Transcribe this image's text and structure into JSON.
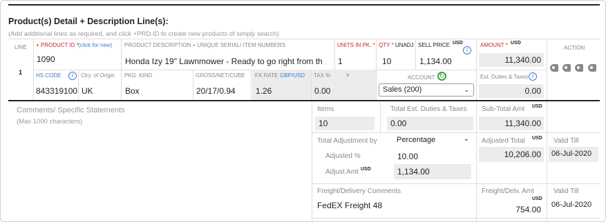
{
  "header": {
    "title": "Product(s) Detail + Description Line(s):",
    "subtitle": "(Add additional lines as required, and click +PRD.ID to create new products of simply search)"
  },
  "line": {
    "line_label": "LINE",
    "line_number": "1",
    "product_id_label": "+ PRODUCT ID",
    "product_id_req": "*",
    "product_id_link": "(click for new)",
    "product_id_value": "1090",
    "description_label": "PRODUCT DESCRIPTION + UNIQUE SERIAL/ ITEM NUMBERS",
    "description_value": "Honda Izy 19\" Lawnmower - Ready to go right from th",
    "units_label": "UNITS IN PK.",
    "units_req": "*",
    "units_value": "1",
    "qty_label": "QTY",
    "qty_req": "*",
    "qty_unit": "UNADJ",
    "qty_value": "10",
    "sell_price_label": "SELL PRICE",
    "sell_price_currency": "USD",
    "sell_price_value": "1,134.00",
    "amount_label": "AMOUNT",
    "amount_req": "*",
    "amount_currency": "USD",
    "amount_value": "11,340.00",
    "action_label": "ACTION",
    "hs_code_label": "HS CODE",
    "hs_code_value": "843319100",
    "origin_label": "Ctry. of Origin",
    "origin_value": "UK",
    "pkg_kind_label": "PKG. KIND",
    "pkg_kind_value": "Box",
    "gross_label": "GROSS/NET/CUBE",
    "gross_value": "20/17/0.94",
    "fx_label": "FX RATE",
    "fx_pair": "GBP/USD",
    "fx_value": "1.26",
    "tax_label": "TAX %",
    "tax_value": "0.00",
    "account_label": "ACCOUNT",
    "account_value": "Sales (200)",
    "duties_label": "Est. Duties & Taxes",
    "duties_value": "0.00"
  },
  "summary": {
    "comments_label": "Comments/ Specific Statements",
    "comments_hint": "(Max 1000 characters)",
    "items_label": "Items",
    "items_value": "10",
    "total_duties_label": "Total Est. Duties & Taxes",
    "total_duties_value": "0.00",
    "subtotal_label": "Sub-Total Amt",
    "subtotal_currency": "USD",
    "subtotal_value": "11,340.00",
    "adjust_by_label": "Total Adjustment by",
    "adjust_by_value": "Percentage",
    "adjusted_pct_label": "Adjusted %",
    "adjusted_pct_value": "10.00",
    "adjust_amt_label": "Adjust Amt",
    "adjust_amt_currency": "USD",
    "adjust_amt_value": "1,134.00",
    "adjusted_total_label": "Adjusted Total",
    "adjusted_total_currency": "USD",
    "adjusted_total_value": "10,206.00",
    "valid_till_label": "Valid Till",
    "valid_till_value": "06-Jul-2020",
    "freight_comments_label": "Freight/Delivery Comments",
    "freight_comments_value": "FedEX Freight 48",
    "freight_amt_label": "Freight/Delv. Amt",
    "freight_amt_currency": "USD",
    "freight_amt_value": "754.00",
    "freight_valid_label": "Valid Till",
    "freight_valid_value": "06-Jul-2020"
  },
  "icons": {
    "info": "info-icon",
    "refresh": "refresh-icon",
    "action": "copy-icon"
  },
  "colors": {
    "required_red": "#c62828",
    "link_blue": "#3a7bd5",
    "field_gray": "#ececec"
  }
}
